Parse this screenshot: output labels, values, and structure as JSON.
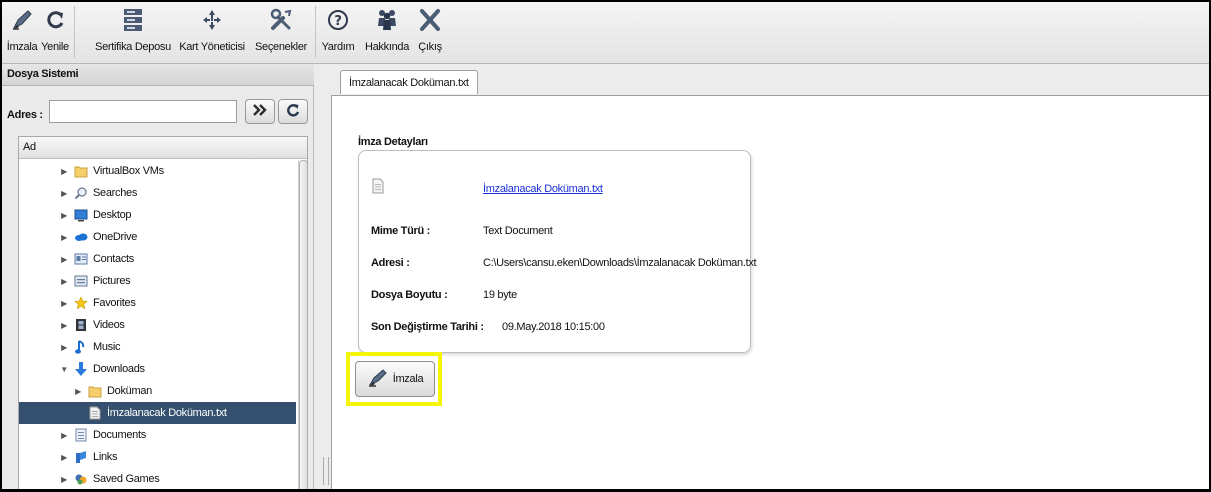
{
  "toolbar": {
    "items": [
      {
        "label": "İmzala",
        "icon": "pen-icon"
      },
      {
        "label": "Yenile",
        "icon": "refresh-icon"
      },
      {
        "label": "Sertifika Deposu",
        "icon": "certificate-store-icon"
      },
      {
        "label": "Kart Yöneticisi",
        "icon": "card-manager-icon"
      },
      {
        "label": "Seçenekler",
        "icon": "tools-icon"
      },
      {
        "label": "Yardım",
        "icon": "help-icon"
      },
      {
        "label": "Hakkında",
        "icon": "people-icon"
      },
      {
        "label": "Çıkış",
        "icon": "exit-icon"
      }
    ]
  },
  "left_panel": {
    "title": "Dosya Sistemi",
    "address_label": "Adres :",
    "address_value": "",
    "column_header": "Ad",
    "tree": [
      {
        "label": "VirtualBox VMs",
        "icon": "folder-icon",
        "arrow": "▶",
        "indent": 0
      },
      {
        "label": "Searches",
        "icon": "search-icon",
        "arrow": "▶",
        "indent": 0
      },
      {
        "label": "Desktop",
        "icon": "desktop-icon",
        "arrow": "▶",
        "indent": 0
      },
      {
        "label": "OneDrive",
        "icon": "cloud-icon",
        "arrow": "▶",
        "indent": 0
      },
      {
        "label": "Contacts",
        "icon": "contacts-icon",
        "arrow": "▶",
        "indent": 0
      },
      {
        "label": "Pictures",
        "icon": "pictures-icon",
        "arrow": "▶",
        "indent": 0
      },
      {
        "label": "Favorites",
        "icon": "star-icon",
        "arrow": "▶",
        "indent": 0
      },
      {
        "label": "Videos",
        "icon": "film-icon",
        "arrow": "▶",
        "indent": 0
      },
      {
        "label": "Music",
        "icon": "music-icon",
        "arrow": "▶",
        "indent": 0
      },
      {
        "label": "Downloads",
        "icon": "download-icon",
        "arrow": "▼",
        "indent": 0
      },
      {
        "label": "Doküman",
        "icon": "folder-icon",
        "arrow": "▶",
        "indent": 1
      },
      {
        "label": "İmzalanacak Doküman.txt",
        "icon": "document-icon",
        "arrow": "",
        "indent": 1,
        "selected": true
      },
      {
        "label": "Documents",
        "icon": "documents-icon",
        "arrow": "▶",
        "indent": 0
      },
      {
        "label": "Links",
        "icon": "link-icon",
        "arrow": "▶",
        "indent": 0
      },
      {
        "label": "Saved Games",
        "icon": "games-icon",
        "arrow": "▶",
        "indent": 0
      }
    ]
  },
  "right_panel": {
    "tab_label": "İmzalanacak Doküman.txt",
    "section_title": "İmza Detayları",
    "file_link": "İmzalanacak Doküman.txt",
    "details": [
      {
        "key": "Mime Türü :",
        "value": "Text Document"
      },
      {
        "key": "Adresi :",
        "value": "C:\\Users\\cansu.eken\\Downloads\\İmzalanacak Doküman.txt"
      },
      {
        "key": "Dosya Boyutu :",
        "value": "19 byte"
      },
      {
        "key": "Son Değiştirme Tarihi :",
        "value": "09.May.2018 10:15:00"
      }
    ],
    "sign_button_label": "İmzala"
  },
  "colors": {
    "selection": "#34506e",
    "link": "#1b2fd6",
    "highlight": "#f5f50a"
  }
}
